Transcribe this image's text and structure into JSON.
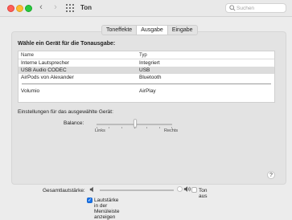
{
  "window": {
    "title": "Ton"
  },
  "search": {
    "placeholder": "Suchen"
  },
  "tabs": [
    {
      "label": "Toneffekte",
      "selected": false
    },
    {
      "label": "Ausgabe",
      "selected": true
    },
    {
      "label": "Eingabe",
      "selected": false
    }
  ],
  "output": {
    "heading": "Wähle ein Gerät für die Tonausgabe:",
    "columns": {
      "name": "Name",
      "type": "Typ"
    },
    "devices": [
      {
        "name": "Interne Lautsprecher",
        "type": "Integriert"
      },
      {
        "name": "USB Audio CODEC",
        "type": "USB"
      },
      {
        "name": "AirPods von Alexander",
        "type": "Bluetooth"
      },
      {
        "name": "Volumio",
        "type": "AirPlay"
      }
    ],
    "selected_index": 1
  },
  "device_settings": {
    "heading": "Einstellungen für das ausgewählte Gerät:",
    "balance_label": "Balance:",
    "balance_left": "Links",
    "balance_right": "Rechts",
    "balance_value": 0.5
  },
  "help": {
    "label": "?"
  },
  "volume": {
    "label": "Gesamtlautstärke:",
    "value": 0.98,
    "mute_label": "Ton aus",
    "mute_checked": false
  },
  "menubar": {
    "label": "Lautstärke in der Menüleiste anzeigen",
    "checked": true
  },
  "colors": {
    "accent": "#1a73e8",
    "close": "#fe5f57",
    "minimize": "#febc2e",
    "zoom": "#28c840"
  }
}
